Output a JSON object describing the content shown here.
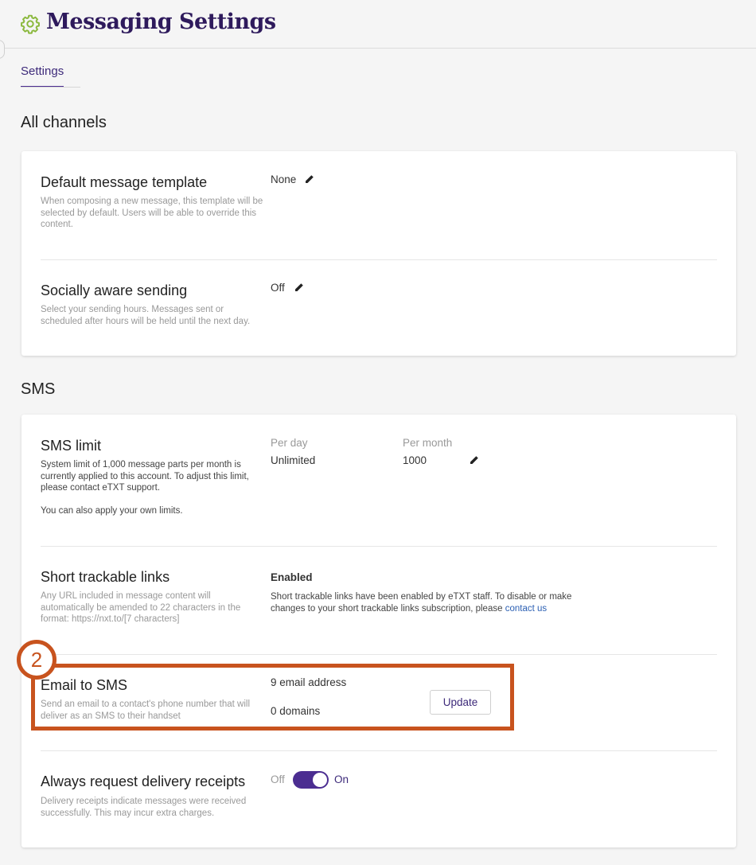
{
  "header": {
    "title": "Messaging Settings",
    "icon": "gear-icon"
  },
  "tabs": [
    {
      "label": "Settings",
      "active": true
    }
  ],
  "sections": {
    "all_channels": {
      "title": "All channels",
      "default_template": {
        "title": "Default message template",
        "description": "When composing a new message, this template will be selected by default. Users will be able to override this content.",
        "value": "None"
      },
      "socially_aware": {
        "title": "Socially aware sending",
        "description": "Select your sending hours. Messages sent or scheduled after hours will be held until the next day.",
        "value": "Off"
      }
    },
    "sms": {
      "title": "SMS",
      "sms_limit": {
        "title": "SMS limit",
        "description": "System limit of 1,000 message parts per month is currently applied to this account. To adjust this limit, please contact eTXT support.",
        "description2": "You can also apply your own limits.",
        "per_day_label": "Per day",
        "per_day_value": "Unlimited",
        "per_month_label": "Per month",
        "per_month_value": "1000"
      },
      "short_links": {
        "title": "Short trackable links",
        "description": "Any URL included in message content will automatically be amended to 22 characters in the format: https://nxt.to/[7 characters]",
        "status": "Enabled",
        "note": "Short trackable links have been enabled by eTXT staff. To disable or make changes to your short trackable links subscription, please",
        "link": "contact us"
      },
      "email_to_sms": {
        "title": "Email to SMS",
        "description": "Send an email to a contact's phone number that will deliver as an SMS to their handset",
        "emails": "9 email address",
        "domains": "0 domains",
        "button": "Update"
      },
      "delivery_receipts": {
        "title": "Always request delivery receipts",
        "description": "Delivery receipts indicate messages were received successfully. This may incur extra charges.",
        "off_label": "Off",
        "on_label": "On",
        "enabled": true
      }
    }
  },
  "annotation": {
    "badge": "2"
  },
  "colors": {
    "accent": "#4b2d91",
    "title": "#2e1a5c",
    "highlight": "#c8531e",
    "gear": "#8ab83c",
    "link": "#2b5fb3"
  }
}
